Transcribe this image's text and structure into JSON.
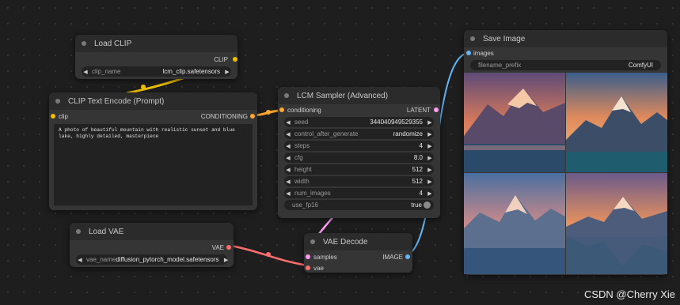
{
  "nodes": {
    "load_clip": {
      "title": "Load CLIP",
      "output": "CLIP",
      "widget": {
        "label": "clip_name",
        "value": "lcm_clip.safetensors"
      }
    },
    "clip_text_encode": {
      "title": "CLIP Text Encode (Prompt)",
      "input": "clip",
      "output": "CONDITIONING",
      "prompt": "A photo of beautiful mountain with realistic sunset and blue lake, highly detailed, masterpiece"
    },
    "lcm_sampler": {
      "title": "LCM Sampler (Advanced)",
      "input": "conditioning",
      "output": "LATENT",
      "widgets": [
        {
          "label": "seed",
          "value": "344040949529355"
        },
        {
          "label": "control_after_generate",
          "value": "randomize"
        },
        {
          "label": "steps",
          "value": "4"
        },
        {
          "label": "cfg",
          "value": "8.0"
        },
        {
          "label": "height",
          "value": "512"
        },
        {
          "label": "width",
          "value": "512"
        },
        {
          "label": "num_images",
          "value": "4"
        }
      ],
      "toggle": {
        "label": "use_fp16",
        "value": "true"
      }
    },
    "load_vae": {
      "title": "Load VAE",
      "output": "VAE",
      "widget": {
        "label": "vae_name",
        "value": "diffusion_pytorch_model.safetensors"
      }
    },
    "vae_decode": {
      "title": "VAE Decode",
      "inputs": [
        "samples",
        "vae"
      ],
      "output": "IMAGE"
    },
    "save_image": {
      "title": "Save Image",
      "input": "images",
      "widget": {
        "label": "filename_prefix",
        "value": "ComfyUI"
      }
    }
  },
  "colors": {
    "clip": "#f0c000",
    "conditioning": "#ffa931",
    "latent": "#ff9cf9",
    "vae": "#ff6e6e",
    "image": "#64b5f6"
  },
  "watermark": "CSDN @Cherry Xie"
}
